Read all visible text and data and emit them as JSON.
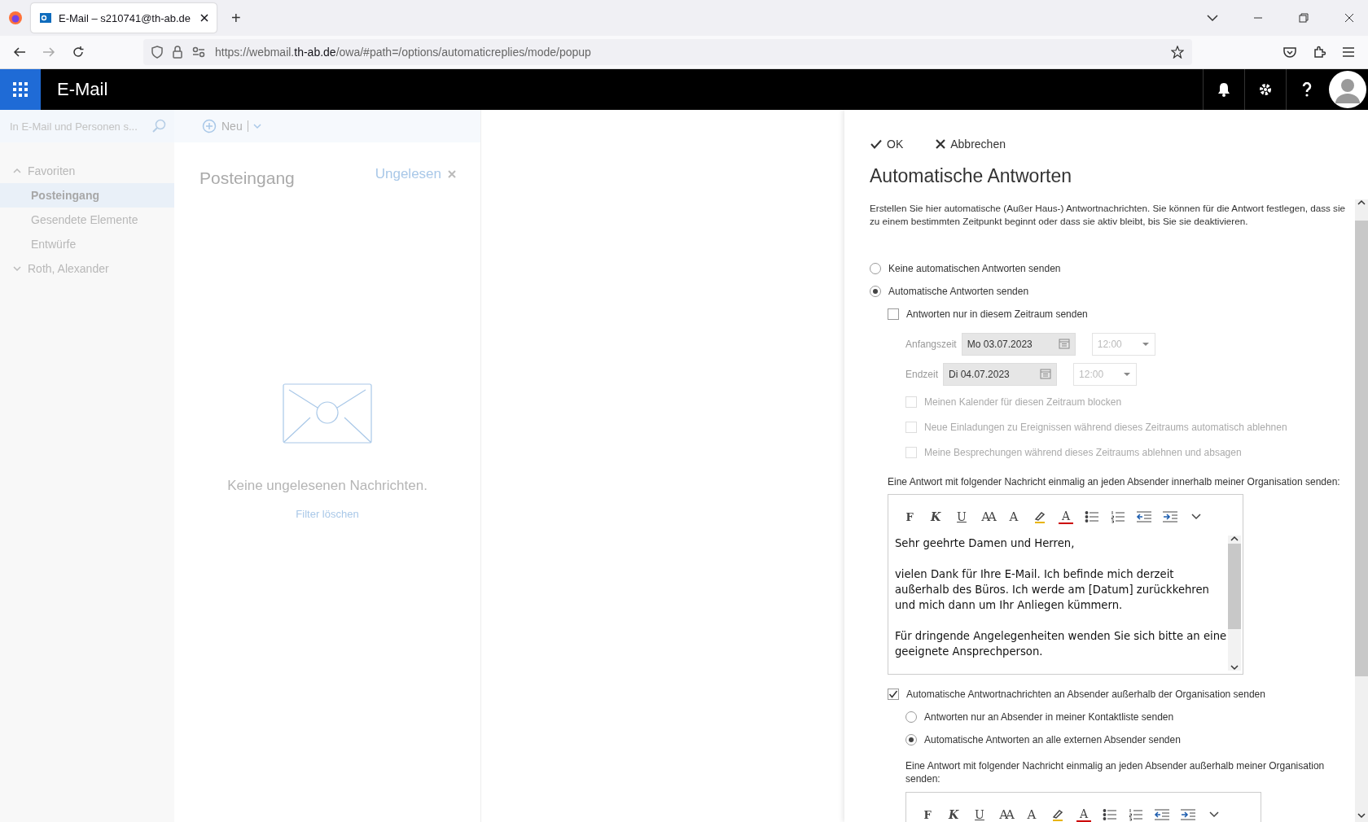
{
  "browser": {
    "tab": {
      "title": "E-Mail – s210741@th-ab.de",
      "selected": true
    },
    "new_tab": "+",
    "url": "https://webmail.**th-ab.de**/owa/#path=/options/automaticreplies/mode/popup"
  },
  "app_bar": {
    "title": "E-Mail"
  },
  "sidebar": {
    "search": {
      "placeholder": "In E-Mail und Personen s..."
    },
    "tree": [
      {
        "label": "Favoriten",
        "expanded": true,
        "children": [
          {
            "label": "Posteingang",
            "selected": true
          },
          {
            "label": "Gesendete Elemente",
            "selected": false
          },
          {
            "label": "Entwürfe",
            "selected": false
          }
        ]
      },
      {
        "label": "Roth, Alexander",
        "expanded": false
      }
    ]
  },
  "command_bar": {
    "new_button": "Neu"
  },
  "message_list": {
    "title": "Posteingang",
    "filter": "Ungelesen",
    "empty_text": "Keine ungelesenen Nachrichten.",
    "clear_filter": "Filter löschen"
  },
  "panel": {
    "ok": "OK",
    "cancel": "Abbrechen",
    "title": "Automatische Antworten",
    "description": "Erstellen Sie hier automatische (Außer Haus-) Antwortnachrichten. Sie können für die Antwort festlegen, dass sie zu einem bestimmten Zeitpunkt beginnt oder dass sie aktiv bleibt, bis Sie sie deaktivieren.",
    "mode": [
      {
        "label": "Keine automatischen Antworten senden",
        "selected": false
      },
      {
        "label": "Automatische Antworten senden",
        "selected": true
      }
    ],
    "schedule": {
      "label": "Antworten nur in diesem Zeitraum senden",
      "checked": false,
      "rows": [
        {
          "label": "Anfangszeit",
          "date": "Mo 03.07.2023",
          "time": "12:00"
        },
        {
          "label": "Endzeit",
          "date": "Di 04.07.2023",
          "time": "12:00"
        }
      ],
      "options": [
        {
          "label": "Meinen Kalender für diesen Zeitraum blocken",
          "checked": false
        },
        {
          "label": "Neue Einladungen zu Ereignissen während dieses Zeitraums automatisch ablehnen",
          "checked": false
        },
        {
          "label": "Meine Besprechungen während dieses Zeitraums ablehnen und absagen",
          "checked": false
        }
      ]
    },
    "internal_label": "Eine Antwort mit folgender Nachricht einmalig an jeden Absender innerhalb meiner Organisation senden:",
    "toolbar": [
      {
        "kind": "bold",
        "label": "F"
      },
      {
        "kind": "italic",
        "label": "K"
      },
      {
        "kind": "underline",
        "label": "U"
      },
      {
        "kind": "size",
        "label": "AA"
      },
      {
        "kind": "grow",
        "label": "A"
      },
      {
        "kind": "highlight"
      },
      {
        "kind": "color",
        "label": "A"
      },
      {
        "kind": "bullets"
      },
      {
        "kind": "numbering"
      },
      {
        "kind": "outdent"
      },
      {
        "kind": "indent"
      },
      {
        "kind": "more"
      }
    ],
    "internal_message": [
      "Sehr geehrte Damen und Herren,",
      "vielen Dank für Ihre E-Mail. Ich befinde mich derzeit außerhalb des Büros. Ich werde am [Datum] zurückkehren und mich dann um Ihr Anliegen kümmern.",
      "Für dringende Angelegenheiten wenden Sie sich bitte an eine geeignete Ansprechperson."
    ],
    "external": {
      "label": "Automatische Antwortnachrichten an Absender außerhalb der Organisation senden",
      "checked": true,
      "audience": [
        {
          "label": "Antworten nur an Absender in meiner Kontaktliste senden",
          "selected": false
        },
        {
          "label": "Automatische Antworten an alle externen Absender senden",
          "selected": true
        }
      ]
    },
    "external_label": "Eine Antwort mit folgender Nachricht einmalig an jeden Absender außerhalb meiner Organisation senden:",
    "external_toolbar": [
      {
        "kind": "bold",
        "label": "F"
      },
      {
        "kind": "italic",
        "label": "K"
      },
      {
        "kind": "underline",
        "label": "U"
      },
      {
        "kind": "size",
        "label": "AA"
      },
      {
        "kind": "grow",
        "label": "A"
      },
      {
        "kind": "highlight"
      },
      {
        "kind": "color",
        "label": "A"
      },
      {
        "kind": "bullets"
      },
      {
        "kind": "numbering"
      },
      {
        "kind": "outdent"
      },
      {
        "kind": "indent"
      },
      {
        "kind": "more"
      }
    ]
  }
}
